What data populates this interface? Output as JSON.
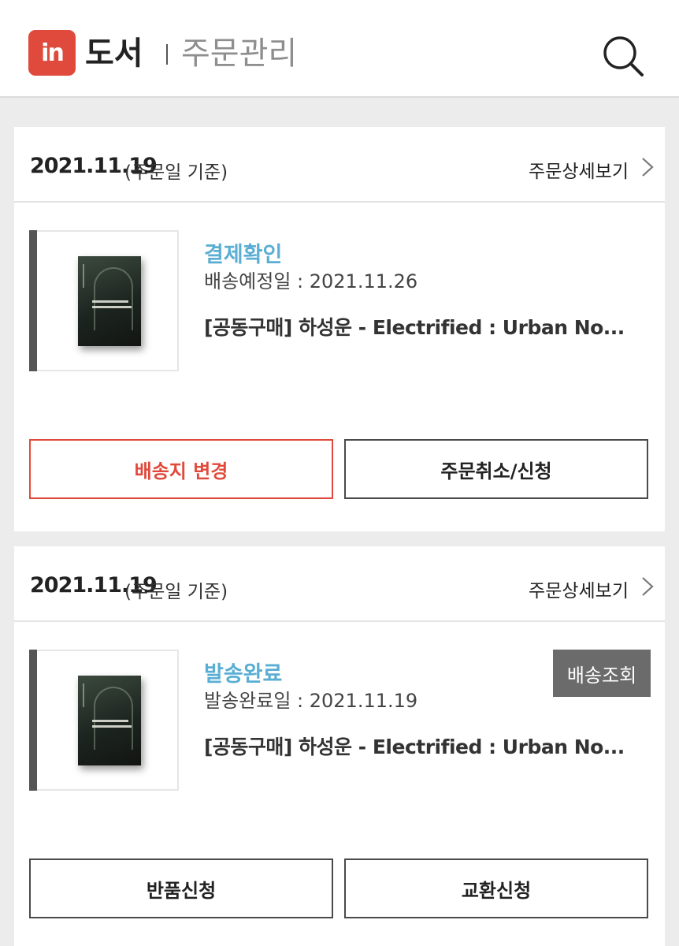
{
  "header": {
    "logo_text": "in",
    "brand": "도서",
    "section_title": "주문관리",
    "search_icon": "search-icon",
    "accent_color": "#e04a3c"
  },
  "orders": [
    {
      "date": "2021.11.19",
      "date_note": "(주문일 기준)",
      "detail_link": "주문상세보기",
      "status": "결제확인",
      "sub_date": "배송예정일 : 2021.11.26",
      "product": "[공동구매] 하성운 - Electrified : Urban No...",
      "buttons": [
        "배송지 변경",
        "주문취소/신청"
      ]
    },
    {
      "date": "2021.11.19",
      "date_note": "(주문일 기준)",
      "detail_link": "주문상세보기",
      "status": "발송완료",
      "sub_date": "발송완료일 : 2021.11.19",
      "product": "[공동구매] 하성운 - Electrified : Urban No...",
      "track_button": "배송조회",
      "buttons": [
        "반품신청",
        "교환신청"
      ]
    }
  ]
}
